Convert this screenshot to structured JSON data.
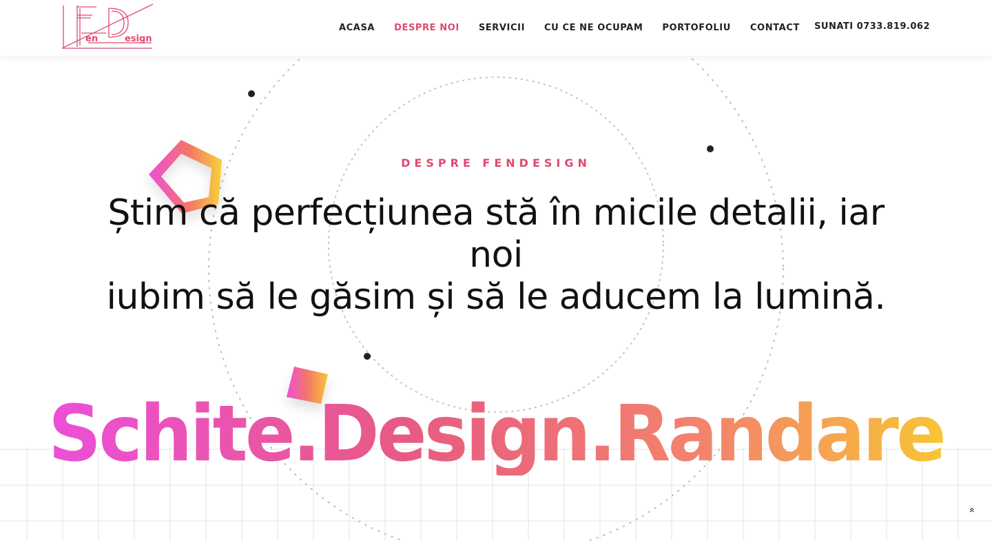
{
  "brand": {
    "logo_letters": "FD",
    "logo_text_en": "en",
    "logo_text_design": "esign",
    "logo_color": "#e0496e"
  },
  "nav": {
    "items": [
      {
        "label": "ACASA",
        "active": false
      },
      {
        "label": "DESPRE NOI",
        "active": true
      },
      {
        "label": "SERVICII",
        "active": false
      },
      {
        "label": "CU CE NE OCUPAM",
        "active": false
      },
      {
        "label": "PORTOFOLIU",
        "active": false
      },
      {
        "label": "CONTACT",
        "active": false
      }
    ],
    "active_color": "#e0496e"
  },
  "contact": {
    "prefix": "SUNATI",
    "phone": "0733.819.062"
  },
  "hero": {
    "eyebrow": "DESPRE FENDESIGN",
    "headline_line1": "Știm că perfecțiunea stă în micile detalii, iar noi",
    "headline_line2": "iubim să le găsim și să le aducem la lumină.",
    "big_text": "Schite.Design.Randare",
    "gradient_colors": [
      "#ec4fd8",
      "#e85a83",
      "#f3766a",
      "#f8c535"
    ]
  },
  "icons": {
    "scroll_top": "double-chevron-up-icon"
  }
}
